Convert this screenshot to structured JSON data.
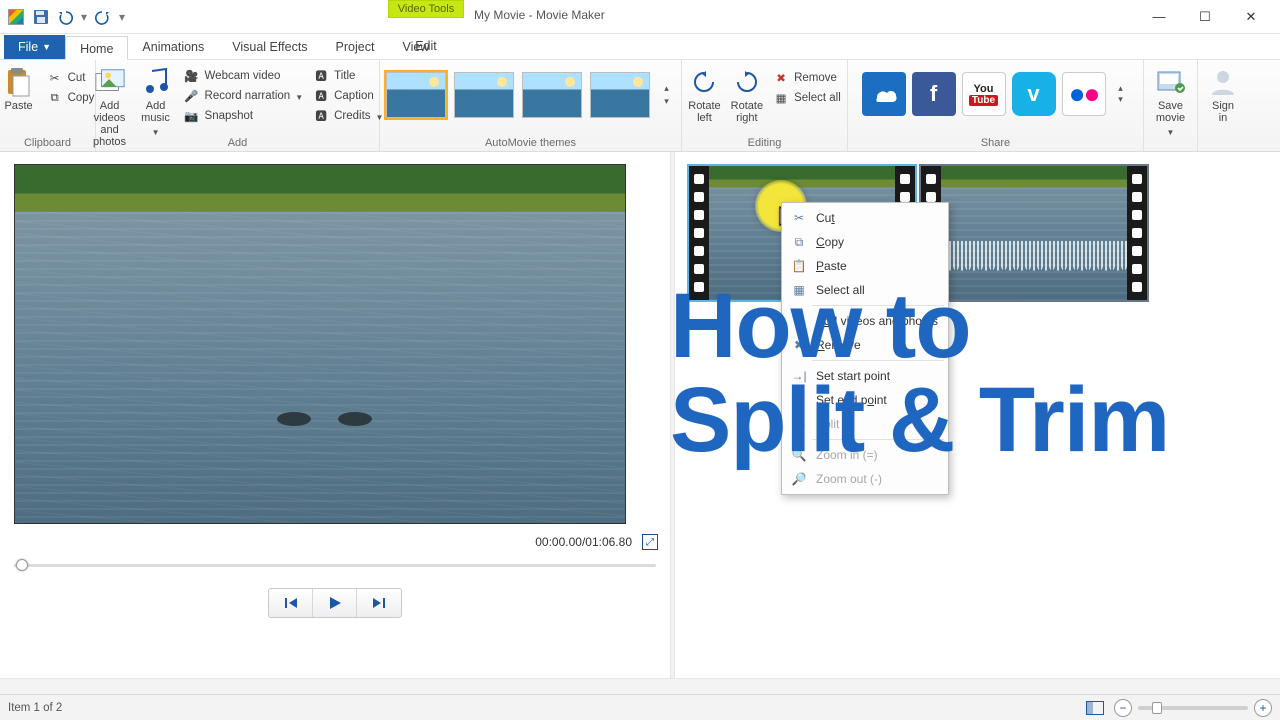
{
  "window": {
    "title": "My Movie - Movie Maker",
    "contextual_group": "Video Tools"
  },
  "qat": {
    "save": "💾",
    "undo": "↶",
    "redo": "↷"
  },
  "tabs": {
    "file": "File",
    "items": [
      "Home",
      "Animations",
      "Visual Effects",
      "Project",
      "View"
    ],
    "contextual": "Edit",
    "active": "Home"
  },
  "ribbon": {
    "clipboard": {
      "label": "Clipboard",
      "paste": "Paste",
      "cut": "Cut",
      "copy": "Copy"
    },
    "add": {
      "label": "Add",
      "add_videos": "Add videos\nand photos",
      "add_music": "Add\nmusic",
      "webcam": "Webcam video",
      "narration": "Record narration",
      "snapshot": "Snapshot",
      "title": "Title",
      "caption": "Caption",
      "credits": "Credits"
    },
    "themes": {
      "label": "AutoMovie themes"
    },
    "editing": {
      "label": "Editing",
      "rotate_left": "Rotate\nleft",
      "rotate_right": "Rotate\nright",
      "remove": "Remove",
      "select_all": "Select all"
    },
    "share": {
      "label": "Share"
    },
    "save": {
      "label": "Save\nmovie"
    },
    "signin": {
      "label": "Sign\nin"
    }
  },
  "preview": {
    "time": "00:00.00/01:06.80"
  },
  "context_menu": {
    "items": [
      {
        "icon": "✂",
        "label": "Cut",
        "u": "t",
        "enabled": true
      },
      {
        "icon": "⧉",
        "label": "Copy",
        "u": "C",
        "enabled": true
      },
      {
        "icon": "📋",
        "label": "Paste",
        "u": "P",
        "enabled": true
      },
      {
        "icon": "▦",
        "label": "Select all",
        "u": "",
        "enabled": true,
        "sep_after": true
      },
      {
        "icon": "＋",
        "label": "Add videos and photos",
        "u": "d",
        "enabled": true
      },
      {
        "icon": "✖",
        "label": "Remove",
        "u": "R",
        "enabled": true,
        "sep_after": true
      },
      {
        "icon": "→|",
        "label": "Set start point",
        "u": "",
        "enabled": true
      },
      {
        "icon": "|←",
        "label": "Set end point",
        "u": "o",
        "enabled": true
      },
      {
        "icon": "—",
        "label": "Split",
        "u": "",
        "enabled": false,
        "sep_after": true
      },
      {
        "icon": "🔍",
        "label": "Zoom in (=)",
        "u": "",
        "enabled": false
      },
      {
        "icon": "🔎",
        "label": "Zoom out (-)",
        "u": "",
        "enabled": false
      }
    ]
  },
  "overlay": {
    "line1": "How to",
    "line2": "Split & Trim"
  },
  "status": {
    "item": "Item 1 of 2"
  }
}
